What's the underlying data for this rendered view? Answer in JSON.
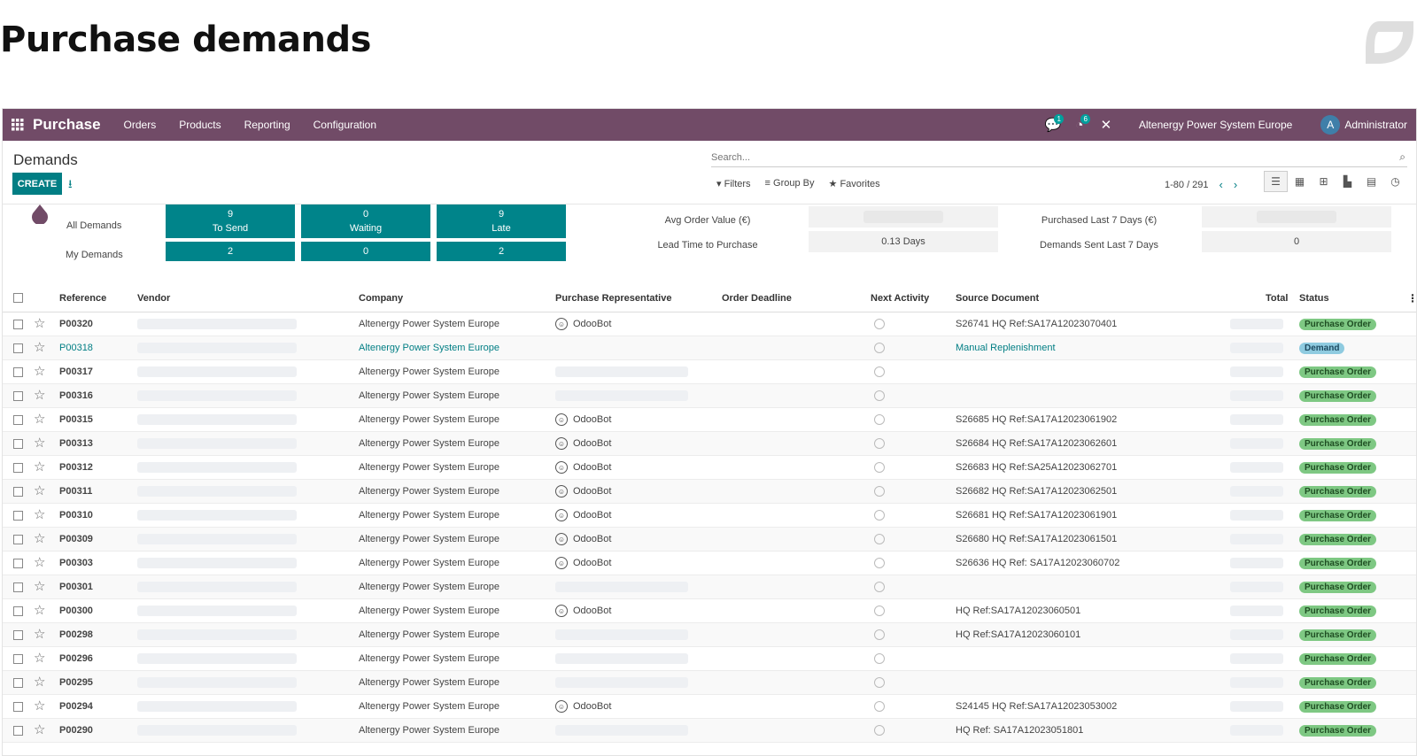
{
  "heading": "Purchase demands",
  "nav": {
    "brand": "Purchase",
    "menus": [
      "Orders",
      "Products",
      "Reporting",
      "Configuration"
    ],
    "messages_badge": "1",
    "activities_badge": "6",
    "company": "Altenergy Power System Europe",
    "avatar_letter": "A",
    "user": "Administrator"
  },
  "control": {
    "breadcrumb": "Demands",
    "create_label": "CREATE",
    "search_placeholder": "Search...",
    "filters_label": "Filters",
    "groupby_label": "Group By",
    "favorites_label": "Favorites",
    "pager": "1-80 / 291"
  },
  "dashboard": {
    "all_label": "All Demands",
    "my_label": "My Demands",
    "tiles": [
      {
        "all_value": "9",
        "all_label": "To Send",
        "my_value": "2"
      },
      {
        "all_value": "0",
        "all_label": "Waiting",
        "my_value": "0"
      },
      {
        "all_value": "9",
        "all_label": "Late",
        "my_value": "2"
      }
    ],
    "kpis": {
      "avg_order_label": "Avg Order Value (€)",
      "lead_time_label": "Lead Time to Purchase",
      "lead_time_value": "0.13  Days",
      "purchased_label": "Purchased Last 7 Days (€)",
      "sent_label": "Demands Sent Last 7 Days",
      "sent_value": "0"
    }
  },
  "table": {
    "headers": {
      "reference": "Reference",
      "vendor": "Vendor",
      "company": "Company",
      "rep": "Purchase Representative",
      "deadline": "Order Deadline",
      "activity": "Next Activity",
      "source": "Source Document",
      "total": "Total",
      "status": "Status"
    },
    "rows": [
      {
        "ref": "P00320",
        "company": "Altenergy Power System Europe",
        "rep": "OdooBot",
        "source": "S26741 HQ Ref:SA17A12023070401",
        "status": "Purchase Order"
      },
      {
        "ref": "P00318",
        "company": "Altenergy Power System Europe",
        "rep": "",
        "source": "Manual Replenishment",
        "status": "Demand"
      },
      {
        "ref": "P00317",
        "company": "Altenergy Power System Europe",
        "rep": "",
        "source": "",
        "status": "Purchase Order"
      },
      {
        "ref": "P00316",
        "company": "Altenergy Power System Europe",
        "rep": "",
        "source": "",
        "status": "Purchase Order"
      },
      {
        "ref": "P00315",
        "company": "Altenergy Power System Europe",
        "rep": "OdooBot",
        "source": "S26685 HQ Ref:SA17A12023061902",
        "status": "Purchase Order"
      },
      {
        "ref": "P00313",
        "company": "Altenergy Power System Europe",
        "rep": "OdooBot",
        "source": "S26684 HQ Ref:SA17A12023062601",
        "status": "Purchase Order"
      },
      {
        "ref": "P00312",
        "company": "Altenergy Power System Europe",
        "rep": "OdooBot",
        "source": "S26683 HQ Ref:SA25A12023062701",
        "status": "Purchase Order"
      },
      {
        "ref": "P00311",
        "company": "Altenergy Power System Europe",
        "rep": "OdooBot",
        "source": "S26682 HQ Ref:SA17A12023062501",
        "status": "Purchase Order"
      },
      {
        "ref": "P00310",
        "company": "Altenergy Power System Europe",
        "rep": "OdooBot",
        "source": "S26681 HQ Ref:SA17A12023061901",
        "status": "Purchase Order"
      },
      {
        "ref": "P00309",
        "company": "Altenergy Power System Europe",
        "rep": "OdooBot",
        "source": "S26680 HQ Ref:SA17A12023061501",
        "status": "Purchase Order"
      },
      {
        "ref": "P00303",
        "company": "Altenergy Power System Europe",
        "rep": "OdooBot",
        "source": "S26636 HQ Ref: SA17A12023060702",
        "status": "Purchase Order"
      },
      {
        "ref": "P00301",
        "company": "Altenergy Power System Europe",
        "rep": "",
        "source": "",
        "status": "Purchase Order"
      },
      {
        "ref": "P00300",
        "company": "Altenergy Power System Europe",
        "rep": "OdooBot",
        "source": "HQ Ref:SA17A12023060501",
        "status": "Purchase Order"
      },
      {
        "ref": "P00298",
        "company": "Altenergy Power System Europe",
        "rep": "",
        "source": "HQ Ref:SA17A12023060101",
        "status": "Purchase Order"
      },
      {
        "ref": "P00296",
        "company": "Altenergy Power System Europe",
        "rep": "",
        "source": "",
        "status": "Purchase Order"
      },
      {
        "ref": "P00295",
        "company": "Altenergy Power System Europe",
        "rep": "",
        "source": "",
        "status": "Purchase Order"
      },
      {
        "ref": "P00294",
        "company": "Altenergy Power System Europe",
        "rep": "OdooBot",
        "source": "S24145 HQ Ref:SA17A12023053002",
        "status": "Purchase Order"
      },
      {
        "ref": "P00290",
        "company": "Altenergy Power System Europe",
        "rep": "",
        "source": "HQ Ref: SA17A12023051801",
        "status": "Purchase Order"
      }
    ]
  },
  "colors": {
    "navbar": "#714B67",
    "primary": "#017e84",
    "tile": "#00848a",
    "status_po": "#7ec883",
    "status_demand": "#8fcbe0"
  }
}
